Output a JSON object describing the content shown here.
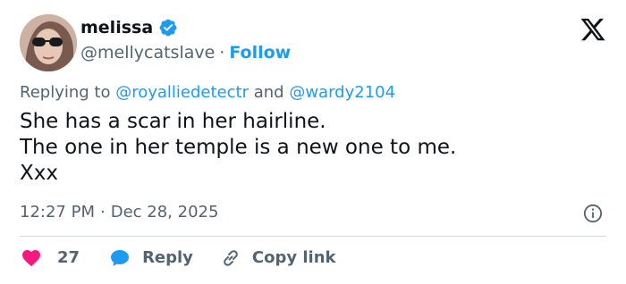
{
  "author": {
    "name": "melissa",
    "handle": "@mellycatslave",
    "separator": "·",
    "follow_label": "Follow",
    "verified": true
  },
  "reply": {
    "prefix": "Replying to",
    "mention_1": "@royalliedetectr",
    "conjunction": "and",
    "mention_2": "@wardy2104"
  },
  "tweet": {
    "lines": [
      "She has a scar in her hairline.",
      "The one in her temple is a new one to me.",
      "Xxx"
    ]
  },
  "meta": {
    "time": "12:27 PM",
    "separator": "·",
    "date": "Dec 28, 2025"
  },
  "actions": {
    "like_count": "27",
    "reply_label": "Reply",
    "copy_label": "Copy link"
  },
  "colors": {
    "accent": "#1d9bf0",
    "like": "#f91880",
    "secondary_text": "#536471",
    "primary_text": "#0f1419",
    "divider": "#cfd9de"
  },
  "icons": {
    "verified": "verified-badge-icon",
    "logo": "x-logo-icon",
    "info": "info-icon",
    "like": "heart-icon",
    "reply": "speech-bubble-icon",
    "copy": "link-icon"
  }
}
